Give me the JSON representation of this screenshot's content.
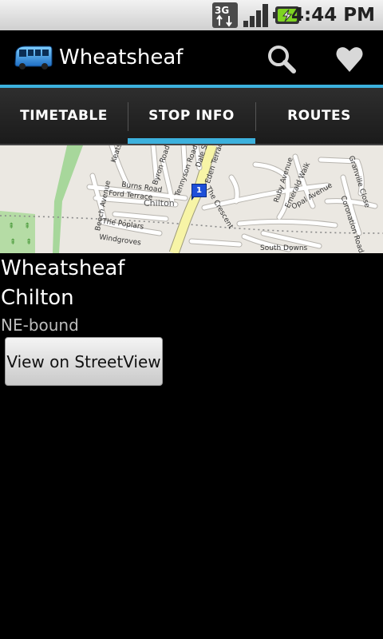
{
  "status_bar": {
    "network": "3G",
    "time": "4:44 PM",
    "icons": [
      "network-3g-icon",
      "signal-icon",
      "battery-charging-icon"
    ]
  },
  "action_bar": {
    "title": "Wheatsheaf",
    "icons": [
      "bus-icon",
      "search-icon",
      "heart-icon"
    ]
  },
  "tabs": [
    {
      "label": "TIMETABLE",
      "active": false
    },
    {
      "label": "STOP INFO",
      "active": true
    },
    {
      "label": "ROUTES",
      "active": false
    }
  ],
  "map": {
    "marker_label": "1",
    "labels": {
      "keats_road": "Keats Road",
      "byron_road": "Byron Road",
      "dale_street": "Dale Street",
      "eden_terrace": "Eden Terrace",
      "tennyson_road": "Tennyson Road",
      "burns_road": "Burns Road",
      "ford_terrace": "Ford Terrace",
      "chilton": "Chilton",
      "the_crescent": "The Crescent",
      "ruby_avenue": "Ruby Avenue",
      "emerald_walk": "Emerald Walk",
      "opal_avenue": "Opal Avenue",
      "granville_close": "Granville Close",
      "coronation_road": "Coronation Road",
      "beech_avenue": "Beech Avenue",
      "the_poplars": "The Poplars",
      "windgroves": "Windgroves",
      "south_downs": "South Downs"
    }
  },
  "stop": {
    "name": "Wheatsheaf",
    "area": "Chilton",
    "direction": "NE-bound"
  },
  "buttons": {
    "streetview": "View on StreetView"
  },
  "colors": {
    "accent": "#3cb1dd",
    "marker": "#1d4fd8",
    "main_road": "#f7f4a6"
  }
}
